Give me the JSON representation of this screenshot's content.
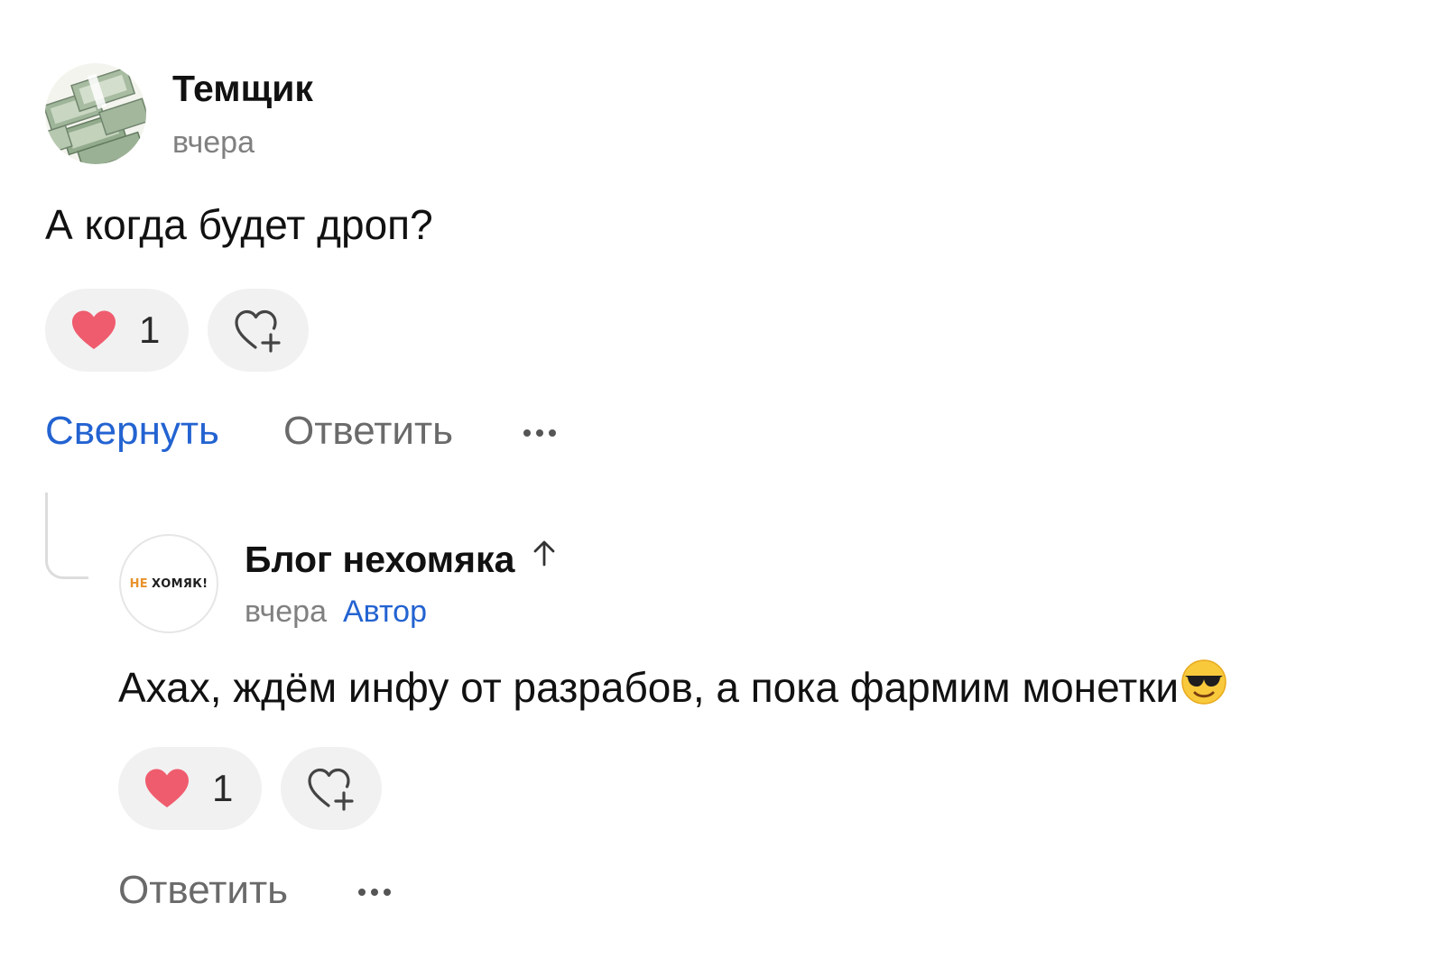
{
  "comment": {
    "author": "Темщик",
    "time": "вчера",
    "text": "А когда будет дроп?",
    "likes": "1",
    "actions": {
      "collapse": "Свернуть",
      "reply": "Ответить"
    }
  },
  "reply": {
    "author": "Блог нехомяка",
    "time": "вчера",
    "badge": "Автор",
    "avatar_logo_accent": "НЕ",
    "avatar_logo_rest": "ХОМЯК!",
    "text": "Ахах, ждём инфу от разрабов, а пока фармим монетки",
    "likes": "1",
    "actions": {
      "reply": "Ответить"
    }
  },
  "icons": {
    "like": "heart-icon",
    "add_reaction": "heart-plus-icon",
    "more": "more-dots-icon",
    "up": "arrow-up-icon",
    "emoji": "sunglasses-emoji"
  },
  "colors": {
    "link_blue": "#2363d1",
    "heart_red": "#ef5c6e",
    "pill_bg": "#f1f1f1",
    "meta_gray": "#808080",
    "logo_orange": "#e8922c"
  }
}
